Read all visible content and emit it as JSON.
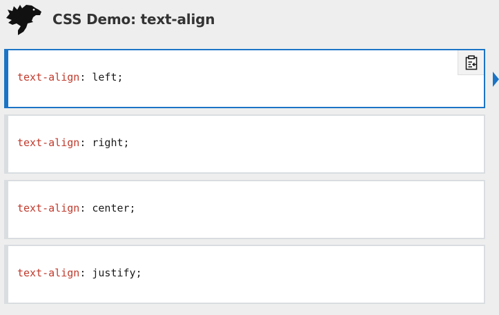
{
  "header": {
    "title": "CSS Demo: text-align",
    "logo_icon": "dinosaur-logo-icon"
  },
  "examples": [
    {
      "property": "text-align",
      "colon": ":",
      "value": " left;",
      "selected": true
    },
    {
      "property": "text-align",
      "colon": ":",
      "value": " right;",
      "selected": false
    },
    {
      "property": "text-align",
      "colon": ":",
      "value": " center;",
      "selected": false
    },
    {
      "property": "text-align",
      "colon": ":",
      "value": " justify;",
      "selected": false
    }
  ],
  "copy_button": {
    "icon": "clipboard-copy-icon"
  },
  "colors": {
    "accent": "#1b74c5",
    "property": "#c0392b",
    "background": "#eeeeee"
  }
}
